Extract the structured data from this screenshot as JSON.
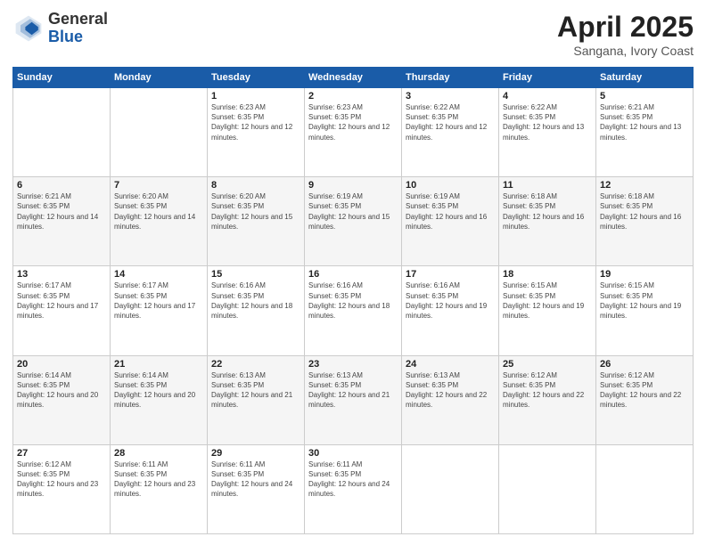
{
  "logo": {
    "general": "General",
    "blue": "Blue"
  },
  "title": "April 2025",
  "subtitle": "Sangana, Ivory Coast",
  "days_of_week": [
    "Sunday",
    "Monday",
    "Tuesday",
    "Wednesday",
    "Thursday",
    "Friday",
    "Saturday"
  ],
  "weeks": [
    [
      {
        "day": "",
        "info": ""
      },
      {
        "day": "",
        "info": ""
      },
      {
        "day": "1",
        "info": "Sunrise: 6:23 AM\nSunset: 6:35 PM\nDaylight: 12 hours and 12 minutes."
      },
      {
        "day": "2",
        "info": "Sunrise: 6:23 AM\nSunset: 6:35 PM\nDaylight: 12 hours and 12 minutes."
      },
      {
        "day": "3",
        "info": "Sunrise: 6:22 AM\nSunset: 6:35 PM\nDaylight: 12 hours and 12 minutes."
      },
      {
        "day": "4",
        "info": "Sunrise: 6:22 AM\nSunset: 6:35 PM\nDaylight: 12 hours and 13 minutes."
      },
      {
        "day": "5",
        "info": "Sunrise: 6:21 AM\nSunset: 6:35 PM\nDaylight: 12 hours and 13 minutes."
      }
    ],
    [
      {
        "day": "6",
        "info": "Sunrise: 6:21 AM\nSunset: 6:35 PM\nDaylight: 12 hours and 14 minutes."
      },
      {
        "day": "7",
        "info": "Sunrise: 6:20 AM\nSunset: 6:35 PM\nDaylight: 12 hours and 14 minutes."
      },
      {
        "day": "8",
        "info": "Sunrise: 6:20 AM\nSunset: 6:35 PM\nDaylight: 12 hours and 15 minutes."
      },
      {
        "day": "9",
        "info": "Sunrise: 6:19 AM\nSunset: 6:35 PM\nDaylight: 12 hours and 15 minutes."
      },
      {
        "day": "10",
        "info": "Sunrise: 6:19 AM\nSunset: 6:35 PM\nDaylight: 12 hours and 16 minutes."
      },
      {
        "day": "11",
        "info": "Sunrise: 6:18 AM\nSunset: 6:35 PM\nDaylight: 12 hours and 16 minutes."
      },
      {
        "day": "12",
        "info": "Sunrise: 6:18 AM\nSunset: 6:35 PM\nDaylight: 12 hours and 16 minutes."
      }
    ],
    [
      {
        "day": "13",
        "info": "Sunrise: 6:17 AM\nSunset: 6:35 PM\nDaylight: 12 hours and 17 minutes."
      },
      {
        "day": "14",
        "info": "Sunrise: 6:17 AM\nSunset: 6:35 PM\nDaylight: 12 hours and 17 minutes."
      },
      {
        "day": "15",
        "info": "Sunrise: 6:16 AM\nSunset: 6:35 PM\nDaylight: 12 hours and 18 minutes."
      },
      {
        "day": "16",
        "info": "Sunrise: 6:16 AM\nSunset: 6:35 PM\nDaylight: 12 hours and 18 minutes."
      },
      {
        "day": "17",
        "info": "Sunrise: 6:16 AM\nSunset: 6:35 PM\nDaylight: 12 hours and 19 minutes."
      },
      {
        "day": "18",
        "info": "Sunrise: 6:15 AM\nSunset: 6:35 PM\nDaylight: 12 hours and 19 minutes."
      },
      {
        "day": "19",
        "info": "Sunrise: 6:15 AM\nSunset: 6:35 PM\nDaylight: 12 hours and 19 minutes."
      }
    ],
    [
      {
        "day": "20",
        "info": "Sunrise: 6:14 AM\nSunset: 6:35 PM\nDaylight: 12 hours and 20 minutes."
      },
      {
        "day": "21",
        "info": "Sunrise: 6:14 AM\nSunset: 6:35 PM\nDaylight: 12 hours and 20 minutes."
      },
      {
        "day": "22",
        "info": "Sunrise: 6:13 AM\nSunset: 6:35 PM\nDaylight: 12 hours and 21 minutes."
      },
      {
        "day": "23",
        "info": "Sunrise: 6:13 AM\nSunset: 6:35 PM\nDaylight: 12 hours and 21 minutes."
      },
      {
        "day": "24",
        "info": "Sunrise: 6:13 AM\nSunset: 6:35 PM\nDaylight: 12 hours and 22 minutes."
      },
      {
        "day": "25",
        "info": "Sunrise: 6:12 AM\nSunset: 6:35 PM\nDaylight: 12 hours and 22 minutes."
      },
      {
        "day": "26",
        "info": "Sunrise: 6:12 AM\nSunset: 6:35 PM\nDaylight: 12 hours and 22 minutes."
      }
    ],
    [
      {
        "day": "27",
        "info": "Sunrise: 6:12 AM\nSunset: 6:35 PM\nDaylight: 12 hours and 23 minutes."
      },
      {
        "day": "28",
        "info": "Sunrise: 6:11 AM\nSunset: 6:35 PM\nDaylight: 12 hours and 23 minutes."
      },
      {
        "day": "29",
        "info": "Sunrise: 6:11 AM\nSunset: 6:35 PM\nDaylight: 12 hours and 24 minutes."
      },
      {
        "day": "30",
        "info": "Sunrise: 6:11 AM\nSunset: 6:35 PM\nDaylight: 12 hours and 24 minutes."
      },
      {
        "day": "",
        "info": ""
      },
      {
        "day": "",
        "info": ""
      },
      {
        "day": "",
        "info": ""
      }
    ]
  ]
}
